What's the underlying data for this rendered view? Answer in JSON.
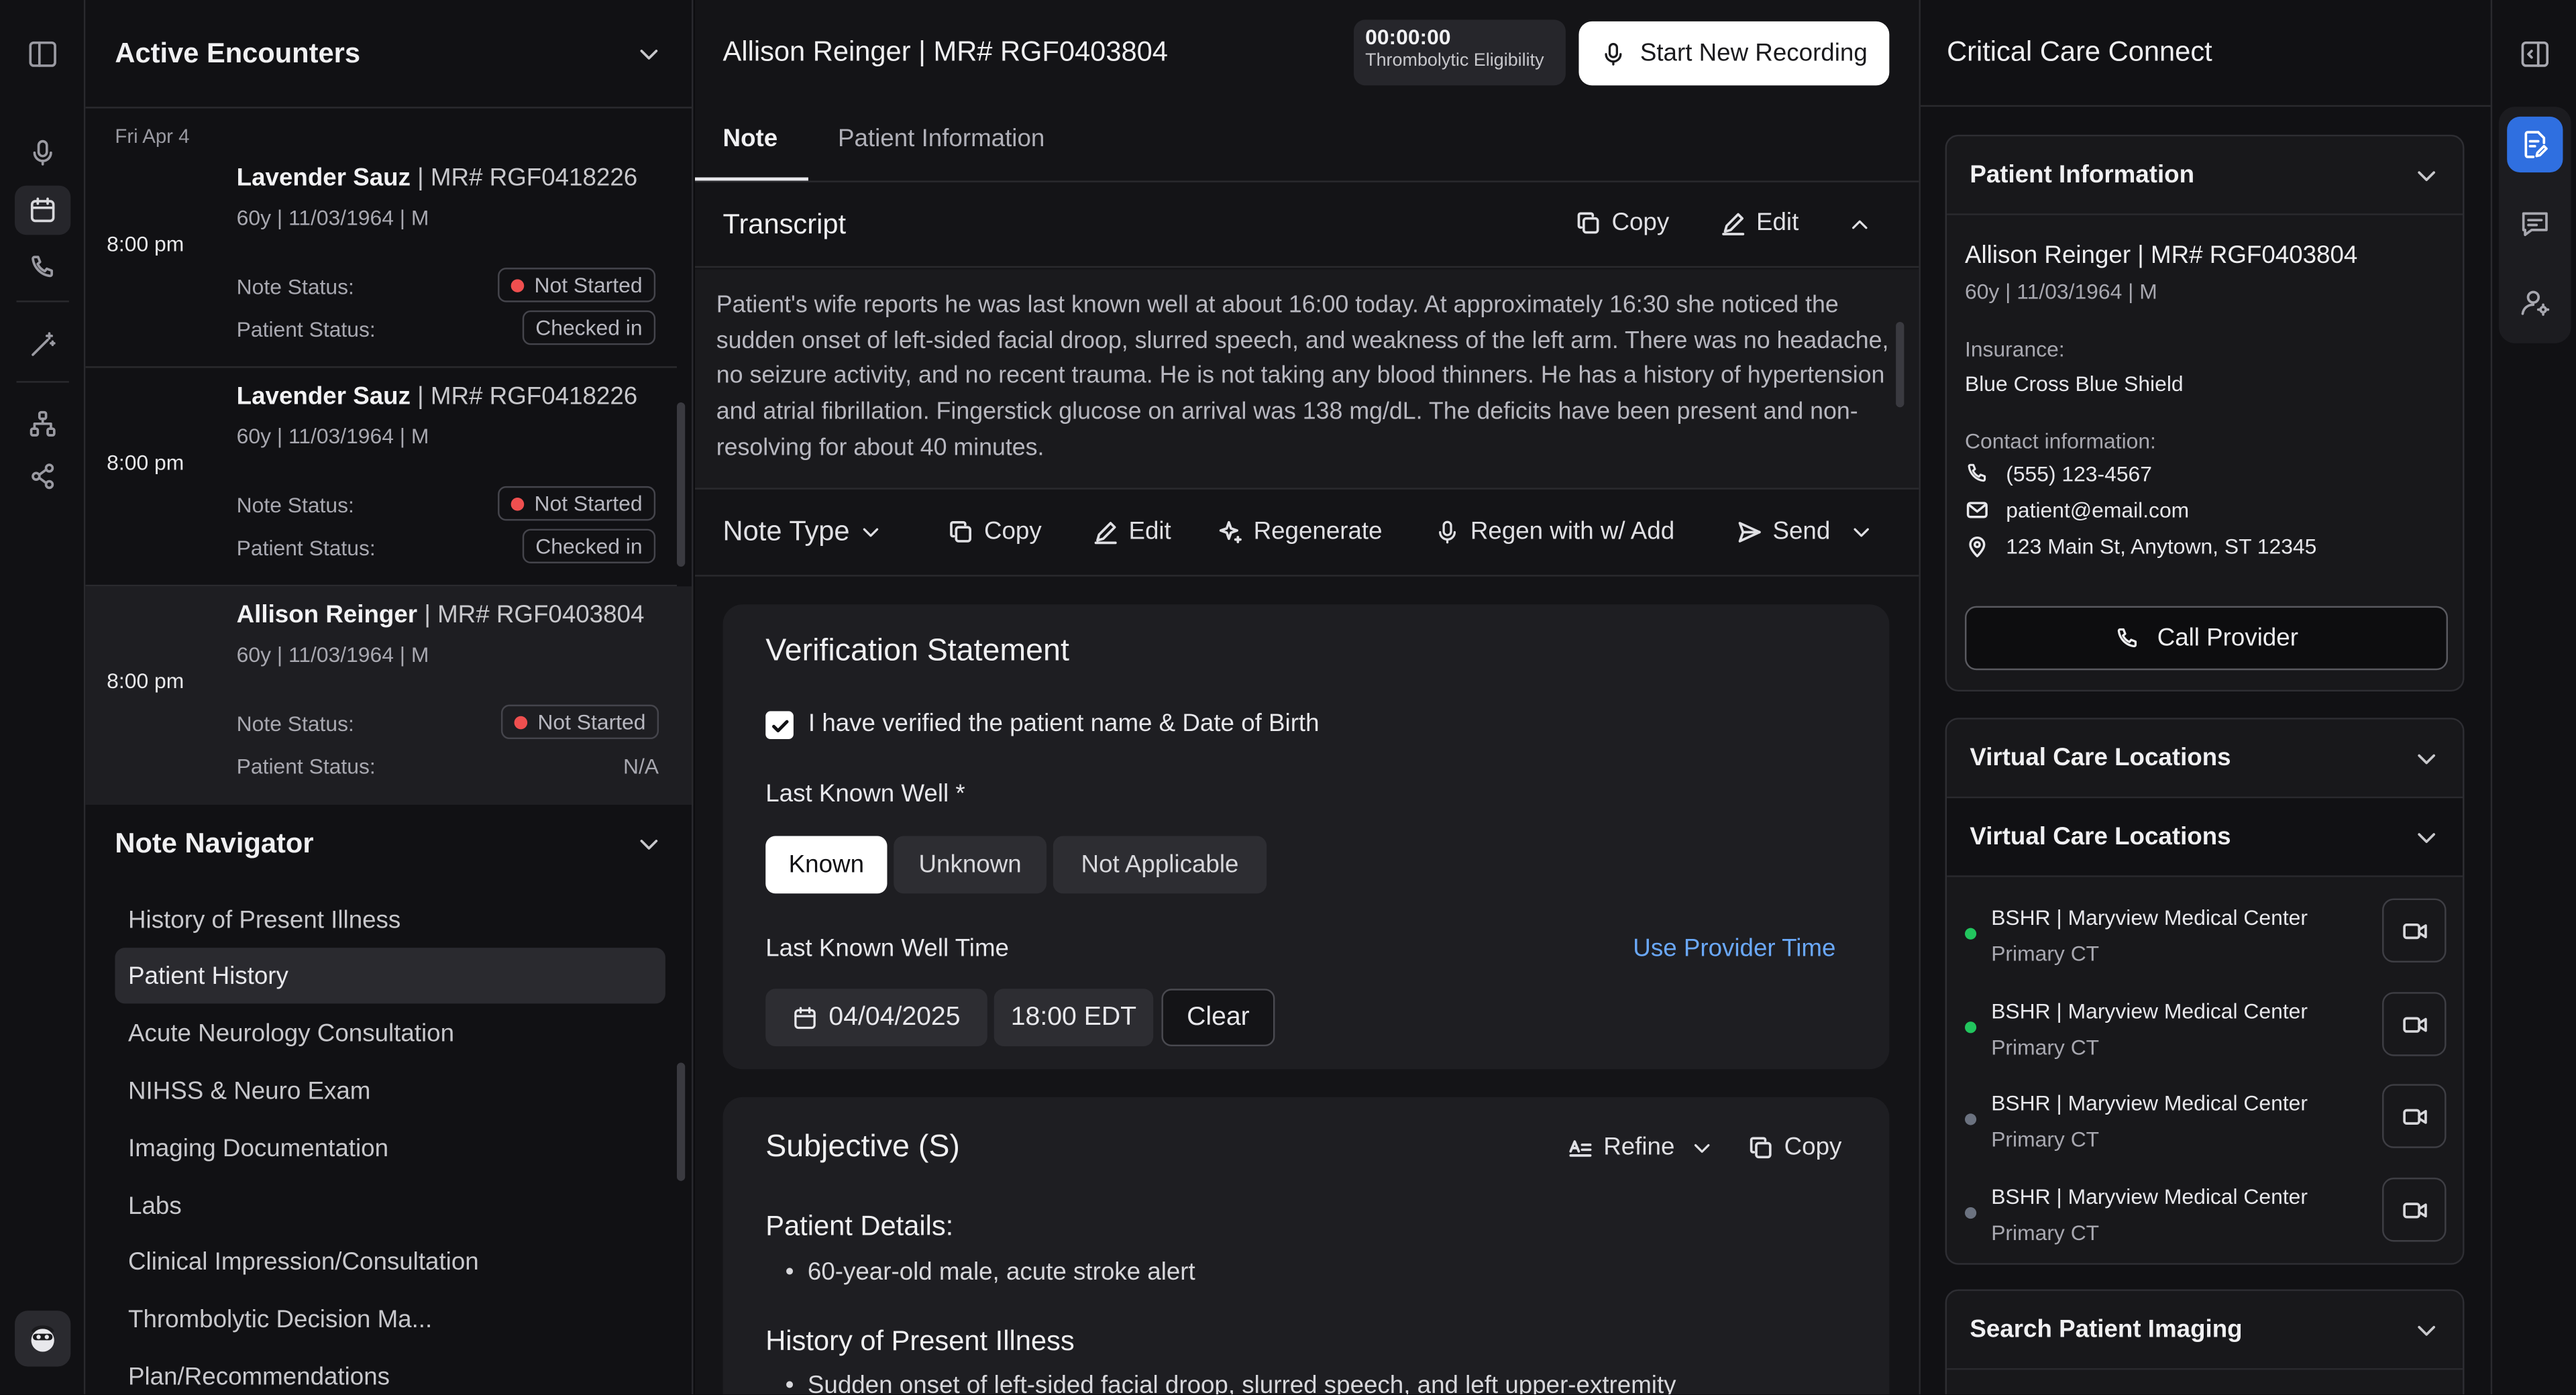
{
  "colors": {
    "accent": "#2f6fe0",
    "link": "#6aa8f8",
    "status_red": "#ef4f4f",
    "online_green": "#22c55e",
    "offline_gray": "#6b7280"
  },
  "rail": {
    "icons": [
      "sidebar-toggle-icon",
      "microphone-icon",
      "calendar-icon",
      "phone-icon",
      "magic-wand-icon",
      "hierarchy-icon",
      "share-icon",
      "avatar-icon"
    ]
  },
  "encounters": {
    "title": "Active Encounters",
    "date": "Fri Apr 4",
    "labels": {
      "note_status": "Note Status:",
      "patient_status": "Patient Status:"
    },
    "items": [
      {
        "time": "8:00 pm",
        "name": "Lavender Sauz",
        "mr": " | MR# RGF0418226",
        "details": "60y | 11/03/1964 | M",
        "note_status": "Not Started",
        "patient_status": "Checked in"
      },
      {
        "time": "8:00 pm",
        "name": "Lavender Sauz",
        "mr": " | MR# RGF0418226",
        "details": "60y | 11/03/1964 | M",
        "note_status": "Not Started",
        "patient_status": "Checked in"
      },
      {
        "time": "8:00 pm",
        "name": "Allison Reinger",
        "mr": " | MR# RGF0403804",
        "details": "60y | 11/03/1964 | M",
        "note_status": "Not Started",
        "patient_status": "N/A"
      }
    ]
  },
  "navigator": {
    "title": "Note Navigator",
    "items": [
      "History of Present Illness",
      "Patient History",
      "Acute Neurology Consultation",
      "NIHSS & Neuro Exam",
      "Imaging Documentation",
      "Labs",
      "Clinical Impression/Consultation",
      "Thrombolytic Decision Ma...",
      "Plan/Recommendations"
    ],
    "selected_index": 1
  },
  "main": {
    "title": "Allison Reinger | MR# RGF0403804",
    "timer": "00:00:00",
    "timer_label": "Thrombolytic Eligibility",
    "record_button": "Start New Recording",
    "tabs": [
      "Note",
      "Patient Information"
    ],
    "transcript": {
      "title": "Transcript",
      "copy": "Copy",
      "edit": "Edit",
      "text": "Patient's wife reports he was last known well at about 16:00 today. At approximately 16:30 she noticed the sudden onset of left-sided facial droop, slurred speech, and weakness of the left arm. There was no headache, no seizure activity, and no recent trauma. He is not taking any blood thinners. He has a history of hypertension and atrial fibrillation. Fingerstick glucose on arrival was 138 mg/dL. The deficits have been present and non-resolving for about 40 minutes."
    },
    "toolbar": {
      "note_type": "Note Type",
      "copy": "Copy",
      "edit": "Edit",
      "regenerate": "Regenerate",
      "regen_add": "Regen with w/ Add",
      "send": "Send"
    },
    "verification": {
      "title": "Verification Statement",
      "checkbox_label": "I have verified the patient name & Date of Birth",
      "checked": true,
      "lkw_label": "Last Known Well *",
      "lkw_options": [
        "Known",
        "Unknown",
        "Not Applicable"
      ],
      "lkw_selected": "Known",
      "lkw_time_label": "Last Known Well Time",
      "use_provider_time": "Use Provider Time",
      "date": "04/04/2025",
      "time": "18:00 EDT",
      "clear": "Clear"
    },
    "subjective": {
      "title": "Subjective (S)",
      "refine": "Refine",
      "copy": "Copy",
      "patient_details_heading": "Patient Details:",
      "patient_details_bullet": "60-year-old male, acute stroke alert",
      "hpi_heading": "History of Present Illness",
      "hpi_bullet": "Sudden onset of left-sided facial droop, slurred speech, and left upper-extremity"
    }
  },
  "right": {
    "title": "Critical Care Connect",
    "patient_info": {
      "title": "Patient Information",
      "name": "Allison Reinger | MR# RGF0403804",
      "details": "60y | 11/03/1964 | M",
      "insurance_label": "Insurance:",
      "insurance": "Blue Cross Blue Shield",
      "contact_label": "Contact information:",
      "phone": "(555) 123-4567",
      "email": "patient@email.com",
      "address": "123 Main St, Anytown, ST 12345",
      "call_button": "Call Provider"
    },
    "virtual_care_title_1": "Virtual Care Locations",
    "virtual_care_title_2": "Virtual Care Locations",
    "locations": [
      {
        "name": "BSHR | Maryview Medical Center",
        "sub": "Primary CT",
        "status": "online"
      },
      {
        "name": "BSHR | Maryview Medical Center",
        "sub": "Primary CT",
        "status": "online"
      },
      {
        "name": "BSHR | Maryview Medical Center",
        "sub": "Primary CT",
        "status": "offline"
      },
      {
        "name": "BSHR | Maryview Medical Center",
        "sub": "Primary CT",
        "status": "offline"
      }
    ],
    "imaging_title": "Search Patient Imaging"
  },
  "right_rail": {
    "icons": [
      "panel-toggle-icon",
      "document-edit-icon",
      "chat-icon",
      "user-settings-icon"
    ]
  }
}
